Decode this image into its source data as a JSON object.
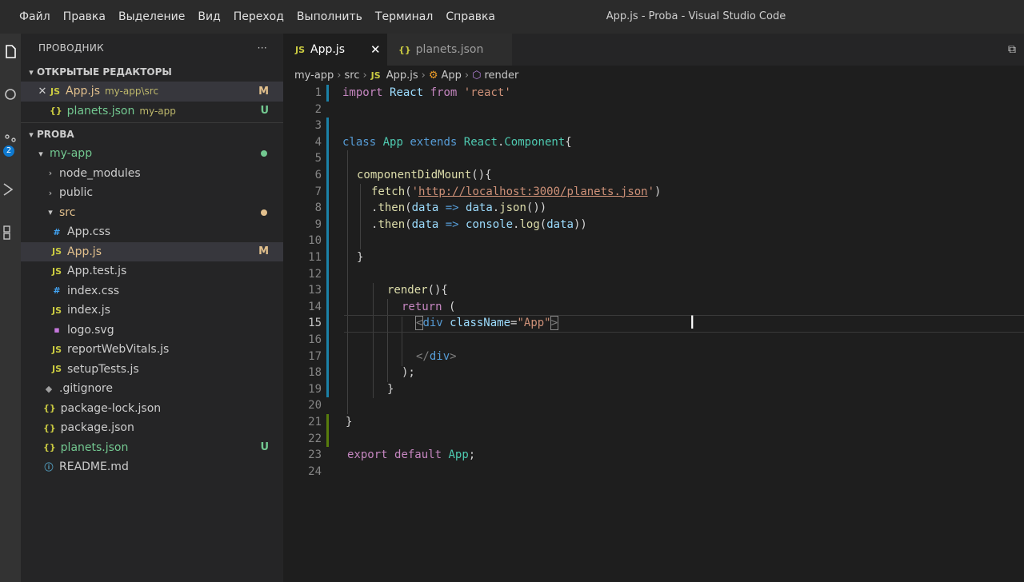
{
  "menu": [
    "Файл",
    "Правка",
    "Выделение",
    "Вид",
    "Переход",
    "Выполнить",
    "Терминал",
    "Справка"
  ],
  "window_title": "App.js - Proba - Visual Studio Code",
  "activity": {
    "source_control_badge": "2"
  },
  "explorer": {
    "title": "ПРОВОДНИК",
    "more": "···",
    "open_editors": {
      "label": "ОТКРЫТЫЕ РЕДАКТОРЫ",
      "items": [
        {
          "icon": "JS",
          "name": "App.js",
          "path": "my-app\\src",
          "status": "M"
        },
        {
          "icon": "{}",
          "name": "planets.json",
          "path": "my-app",
          "status": "U"
        }
      ]
    },
    "project": {
      "label": "PROBA",
      "tree": [
        {
          "name": "my-app"
        },
        {
          "name": "node_modules"
        },
        {
          "name": "public"
        },
        {
          "name": "src"
        },
        {
          "icon": "#",
          "name": "App.css"
        },
        {
          "icon": "JS",
          "name": "App.js",
          "status": "M"
        },
        {
          "icon": "JS",
          "name": "App.test.js"
        },
        {
          "icon": "#",
          "name": "index.css"
        },
        {
          "icon": "JS",
          "name": "index.js"
        },
        {
          "icon": "▪",
          "name": "logo.svg"
        },
        {
          "icon": "JS",
          "name": "reportWebVitals.js"
        },
        {
          "icon": "JS",
          "name": "setupTests.js"
        },
        {
          "icon": "◆",
          "name": ".gitignore"
        },
        {
          "icon": "{}",
          "name": "package-lock.json"
        },
        {
          "icon": "{}",
          "name": "package.json"
        },
        {
          "icon": "{}",
          "name": "planets.json",
          "status": "U"
        },
        {
          "icon": "ⓘ",
          "name": "README.md"
        }
      ]
    }
  },
  "tabs": [
    {
      "icon": "JS",
      "label": "App.js",
      "close": "✕"
    },
    {
      "icon": "{}",
      "label": "planets.json"
    }
  ],
  "breadcrumb": [
    "my-app",
    "src",
    "App.js",
    "App",
    "render"
  ],
  "editor": {
    "line_numbers": [
      "1",
      "2",
      "3",
      "4",
      "5",
      "6",
      "7",
      "8",
      "9",
      "10",
      "11",
      "12",
      "13",
      "14",
      "15",
      "16",
      "17",
      "18",
      "19",
      "20",
      "21",
      "22",
      "23",
      "24"
    ],
    "code": {
      "l1": {
        "import": "import",
        "react": "React",
        "from": "from",
        "str": "'react'"
      },
      "l4": {
        "class": "class",
        "name": "App",
        "extends": "extends",
        "react": "React",
        "dot": ".",
        "component": "Component",
        "brace": "{"
      },
      "l6": {
        "fn": "componentDidMount",
        "rest": "(){"
      },
      "l7": {
        "fn": "fetch",
        "open": "(",
        "q1": "'",
        "url": "http://localhost:3000/planets.json",
        "q2": "'",
        "close": ")"
      },
      "l8": {
        "dot": ".",
        "then": "then",
        "open": "(",
        "data": "data",
        "arrow": " => ",
        "data2": "data",
        "dot2": ".",
        "json": "json",
        "rest": "())"
      },
      "l9": {
        "dot": ".",
        "then": "then",
        "open": "(",
        "data": "data",
        "arrow": " => ",
        "console": "console",
        "dot2": ".",
        "log": "log",
        "open2": "(",
        "data2": "data",
        "rest": "))"
      },
      "l11": "}",
      "l13": {
        "fn": "render",
        "rest": "(){"
      },
      "l14": {
        "kw": "return",
        "rest": " ("
      },
      "l15": {
        "lt": "<",
        "tag": "div",
        "attr": " className",
        "eq": "=",
        "val": "\"App\"",
        "gt": ">"
      },
      "l17": {
        "lt": "</",
        "tag": "div",
        "gt": ">"
      },
      "l18": ");",
      "l19": "}",
      "l21": "}",
      "l23": {
        "export": "export",
        "default": "default",
        "name": "App",
        "semi": ";"
      }
    }
  },
  "colors": {
    "accent_modified": "#e2c08d",
    "accent_untracked": "#73c991",
    "gutter_modified": "#1b81a8",
    "gutter_added": "#587c0c"
  }
}
